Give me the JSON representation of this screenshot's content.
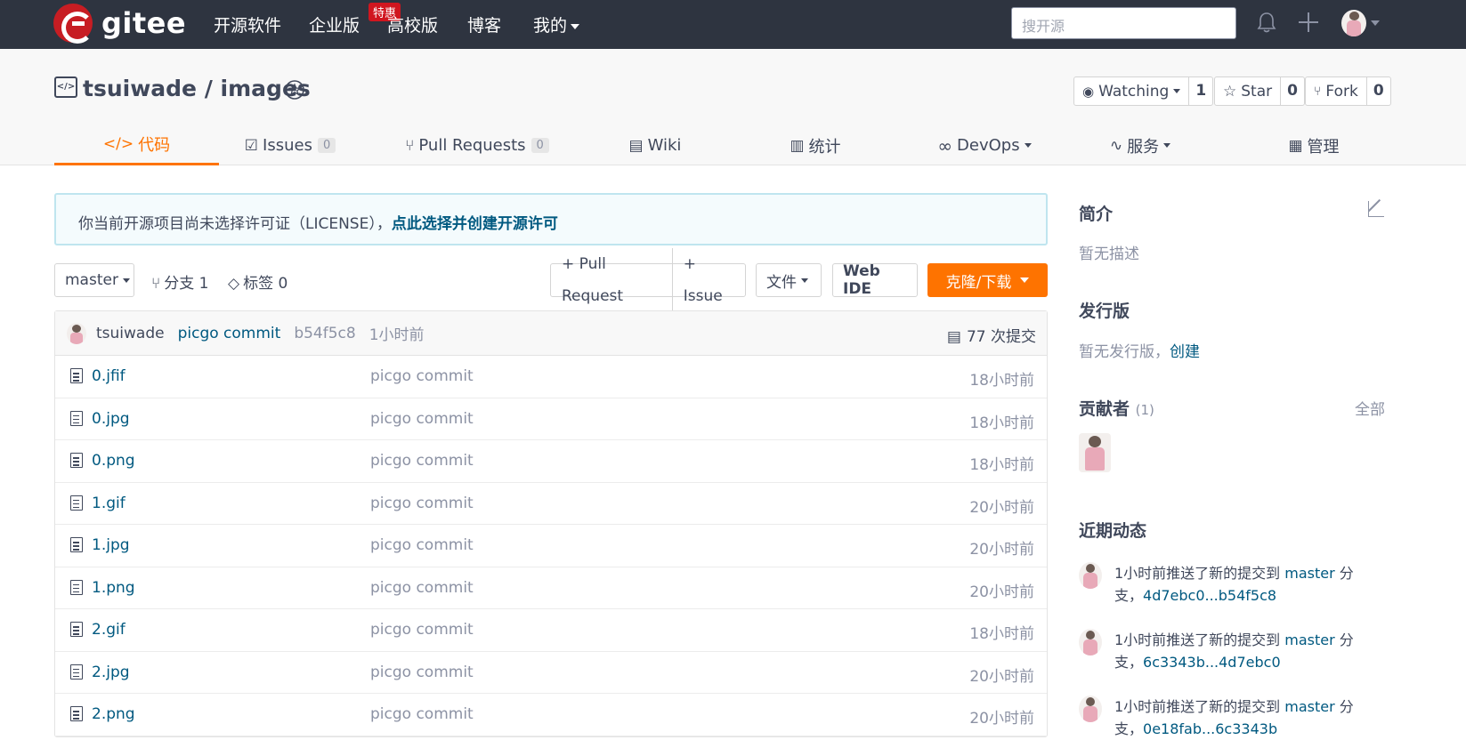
{
  "nav": {
    "logo_text": "gitee",
    "items": [
      "开源软件",
      "企业版",
      "高校版",
      "博客",
      "我的"
    ],
    "enterprise_badge": "特惠",
    "search_placeholder": "搜开源"
  },
  "repo": {
    "owner": "tsuiwade",
    "name": "images",
    "title": "tsuiwade / images",
    "watch_label": "Watching",
    "watch_count": "1",
    "star_label": "Star",
    "star_count": "0",
    "fork_label": "Fork",
    "fork_count": "0"
  },
  "tabs": [
    {
      "label": "代码",
      "icon": "</>"
    },
    {
      "label": "Issues",
      "count": "0"
    },
    {
      "label": "Pull Requests",
      "count": "0"
    },
    {
      "label": "Wiki"
    },
    {
      "label": "统计"
    },
    {
      "label": "DevOps"
    },
    {
      "label": "服务"
    },
    {
      "label": "管理"
    }
  ],
  "license": {
    "text": "你当前开源项目尚未选择许可证（LICENSE），",
    "link": "点此选择并创建开源许可"
  },
  "toolbar": {
    "branch": "master",
    "branches": "分支 1",
    "tags": "标签 0",
    "pull_request": "+ Pull Request",
    "issue": "+ Issue",
    "file": "文件",
    "web_ide": "Web IDE",
    "clone": "克隆/下载"
  },
  "commit": {
    "author": "tsuiwade",
    "message": "picgo commit",
    "sha": "b54f5c8",
    "time": "1小时前",
    "count": "77 次提交"
  },
  "files": [
    {
      "name": "0.jfif",
      "message": "picgo commit",
      "time": "18小时前"
    },
    {
      "name": "0.jpg",
      "message": "picgo commit",
      "time": "18小时前"
    },
    {
      "name": "0.png",
      "message": "picgo commit",
      "time": "18小时前"
    },
    {
      "name": "1.gif",
      "message": "picgo commit",
      "time": "20小时前"
    },
    {
      "name": "1.jpg",
      "message": "picgo commit",
      "time": "20小时前"
    },
    {
      "name": "1.png",
      "message": "picgo commit",
      "time": "20小时前"
    },
    {
      "name": "2.gif",
      "message": "picgo commit",
      "time": "18小时前"
    },
    {
      "name": "2.jpg",
      "message": "picgo commit",
      "time": "20小时前"
    },
    {
      "name": "2.png",
      "message": "picgo commit",
      "time": "20小时前"
    }
  ],
  "sidebar": {
    "intro_title": "简介",
    "intro_text": "暂无描述",
    "release_title": "发行版",
    "release_text": "暂无发行版，",
    "release_link": "创建",
    "contrib_title": "贡献者",
    "contrib_count": "(1)",
    "contrib_all": "全部",
    "activity_title": "近期动态",
    "activities": [
      {
        "text": "1小时前推送了新的提交到 ",
        "branch": "master",
        "suffix": " 分支，",
        "range": "4d7ebc0...b54f5c8"
      },
      {
        "text": "1小时前推送了新的提交到 ",
        "branch": "master",
        "suffix": " 分支，",
        "range": "6c3343b...4d7ebc0"
      },
      {
        "text": "1小时前推送了新的提交到 ",
        "branch": "master",
        "suffix": " 分支，",
        "range": "0e18fab...6c3343b"
      }
    ]
  },
  "colors": {
    "accent": "#fe7300",
    "nav_bg": "#2e3440",
    "link": "#005980",
    "brand_red": "#c71d23"
  }
}
